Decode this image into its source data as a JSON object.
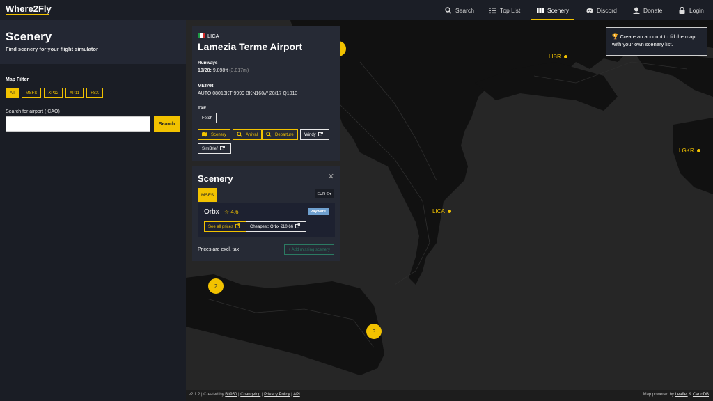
{
  "nav": {
    "logo": "Where2Fly",
    "items": [
      {
        "label": "Search",
        "icon": "search-icon"
      },
      {
        "label": "Top List",
        "icon": "list-icon"
      },
      {
        "label": "Scenery",
        "icon": "map-icon",
        "active": true
      },
      {
        "label": "Discord",
        "icon": "discord-icon"
      },
      {
        "label": "Donate",
        "icon": "donate-icon"
      },
      {
        "label": "Login",
        "icon": "lock-icon"
      }
    ]
  },
  "sidebar": {
    "title": "Scenery",
    "subtitle": "Find scenery for your flight simulator",
    "filter_label": "Map Filter",
    "filters": [
      "All",
      "MSFS",
      "XP12",
      "XP11",
      "FSX"
    ],
    "active_filter": "All",
    "search_label": "Search for airport (ICAO)",
    "search_value": "",
    "search_button": "Search"
  },
  "airport": {
    "icao": "LICA",
    "name": "Lamezia Terme Airport",
    "runways_label": "Runways",
    "runway_id": "10/28:",
    "runway_ft": "9,898ft",
    "runway_m": "(3,017m)",
    "metar_label": "METAR",
    "metar": "AUTO 08013KT 9999 BKN160/// 20/17 Q1013",
    "taf_label": "TAF",
    "fetch_button": "Fetch",
    "actions": [
      "Scenery",
      "Arrival",
      "Departure",
      "Windy",
      "SimBrief"
    ]
  },
  "scenery": {
    "title": "Scenery",
    "tab": "MSFS",
    "currency": "EUR €",
    "vendor": "Orbx",
    "rating": "4.6",
    "badge": "Payware",
    "see_prices": "See all prices",
    "cheapest": "Cheapest: Orbx €10.66",
    "tax_note": "Prices are excl. tax",
    "add_missing": "+ Add missing scenery"
  },
  "map": {
    "labels": [
      {
        "name": "LIBR"
      },
      {
        "name": "LGKR"
      },
      {
        "name": "LICA"
      }
    ],
    "clusters": [
      "2",
      "2",
      "3"
    ]
  },
  "tooltip": "Create an account to fill the map with your own scenery list.",
  "footer": {
    "version": "v2.1.2",
    "created_by": "Created by",
    "author": "Blt950",
    "changelog": "Changelog",
    "privacy": "Privacy Policy",
    "api": "API",
    "map_powered": "Map powered by",
    "leaflet": "Leaflet",
    "amp": "&",
    "cartodb": "CartoDB"
  },
  "colors": {
    "accent": "#f2c200",
    "panel": "#262a35",
    "sidebar": "#1a1d25"
  }
}
